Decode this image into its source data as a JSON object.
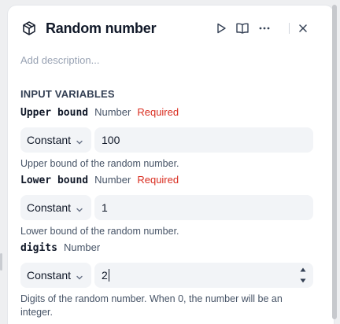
{
  "header": {
    "title": "Random number",
    "icon": "cube-icon",
    "actions": [
      "play-icon",
      "book-icon",
      "more-icon",
      "close-icon"
    ]
  },
  "description_placeholder": "Add description...",
  "section_title": "INPUT VARIABLES",
  "variables": [
    {
      "name": "Upper bound",
      "type": "Number",
      "required": "Required",
      "source": "Constant",
      "value": "100",
      "help": "Upper bound of the random number."
    },
    {
      "name": "Lower bound",
      "type": "Number",
      "required": "Required",
      "source": "Constant",
      "value": "1",
      "help": "Lower bound of the random number."
    },
    {
      "name": "digits",
      "type": "Number",
      "source": "Constant",
      "value": "2",
      "help": "Digits of the random number. When 0, the number will be an integer."
    }
  ],
  "colors": {
    "required": "#d92d20",
    "field_bg": "#f2f4f7",
    "muted": "#98a2b3"
  }
}
